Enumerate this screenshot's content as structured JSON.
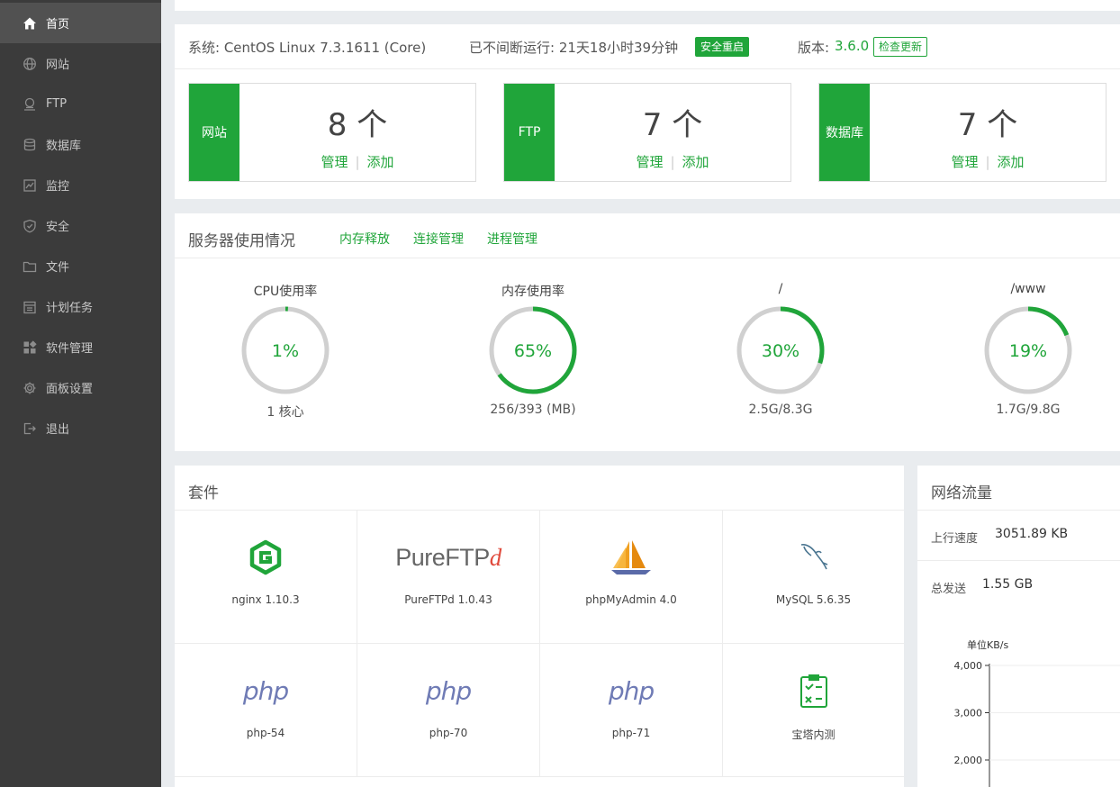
{
  "sidebar": {
    "items": [
      {
        "label": "首页",
        "icon": "home-icon",
        "active": true
      },
      {
        "label": "网站",
        "icon": "globe-icon"
      },
      {
        "label": "FTP",
        "icon": "ftp-icon"
      },
      {
        "label": "数据库",
        "icon": "database-icon"
      },
      {
        "label": "监控",
        "icon": "monitor-icon"
      },
      {
        "label": "安全",
        "icon": "shield-icon"
      },
      {
        "label": "文件",
        "icon": "folder-icon"
      },
      {
        "label": "计划任务",
        "icon": "calendar-icon"
      },
      {
        "label": "软件管理",
        "icon": "apps-icon"
      },
      {
        "label": "面板设置",
        "icon": "gear-icon"
      },
      {
        "label": "退出",
        "icon": "logout-icon"
      }
    ]
  },
  "system": {
    "os_label": "系统: CentOS Linux 7.3.1611 (Core)",
    "uptime_label": "已不间断运行: 21天18小时39分钟",
    "restart_button": "安全重启",
    "version_prefix": "版本: ",
    "version": "3.6.0",
    "check_update_button": "检查更新"
  },
  "stats": [
    {
      "label": "网站",
      "count": "8 个",
      "manage": "管理",
      "add": "添加"
    },
    {
      "label": "FTP",
      "count": "7 个",
      "manage": "管理",
      "add": "添加"
    },
    {
      "label": "数据库",
      "count": "7 个",
      "manage": "管理",
      "add": "添加"
    }
  ],
  "usage": {
    "title": "服务器使用情况",
    "links": [
      "内存释放",
      "连接管理",
      "进程管理"
    ],
    "gauges": [
      {
        "title": "CPU使用率",
        "percent": 1,
        "label": "1%",
        "sub": "1 核心"
      },
      {
        "title": "内存使用率",
        "percent": 65,
        "label": "65%",
        "sub": "256/393 (MB)"
      },
      {
        "title": "/",
        "percent": 30,
        "label": "30%",
        "sub": "2.5G/8.3G"
      },
      {
        "title": "/www",
        "percent": 19,
        "label": "19%",
        "sub": "1.7G/9.8G"
      }
    ]
  },
  "suite": {
    "title": "套件",
    "items": [
      {
        "name": "nginx 1.10.3",
        "icon": "nginx-icon"
      },
      {
        "name": "PureFTPd 1.0.43",
        "icon": "pureftpd-icon",
        "logo_main": "PureFTP",
        "logo_d": "d"
      },
      {
        "name": "phpMyAdmin 4.0",
        "icon": "phpmyadmin-icon"
      },
      {
        "name": "MySQL 5.6.35",
        "icon": "mysql-icon"
      },
      {
        "name": "php-54",
        "icon": "php-icon",
        "logo": "php"
      },
      {
        "name": "php-70",
        "icon": "php-icon",
        "logo": "php"
      },
      {
        "name": "php-71",
        "icon": "php-icon",
        "logo": "php"
      },
      {
        "name": "宝塔内测",
        "icon": "clipboard-check-icon"
      }
    ]
  },
  "network": {
    "title": "网络流量",
    "up_label": "上行速度",
    "up_value": "3051.89 KB",
    "total_label": "总发送",
    "total_value": "1.55 GB"
  },
  "chart_data": {
    "type": "line",
    "ylabel": "单位KB/s",
    "yticks": [
      "4,000",
      "3,000",
      "2,000"
    ],
    "ylim": [
      2000,
      4000
    ],
    "series": []
  },
  "colors": {
    "accent": "#20a53a",
    "sidebar": "#3b3b3b",
    "gauge_track": "#d0d0d0"
  }
}
